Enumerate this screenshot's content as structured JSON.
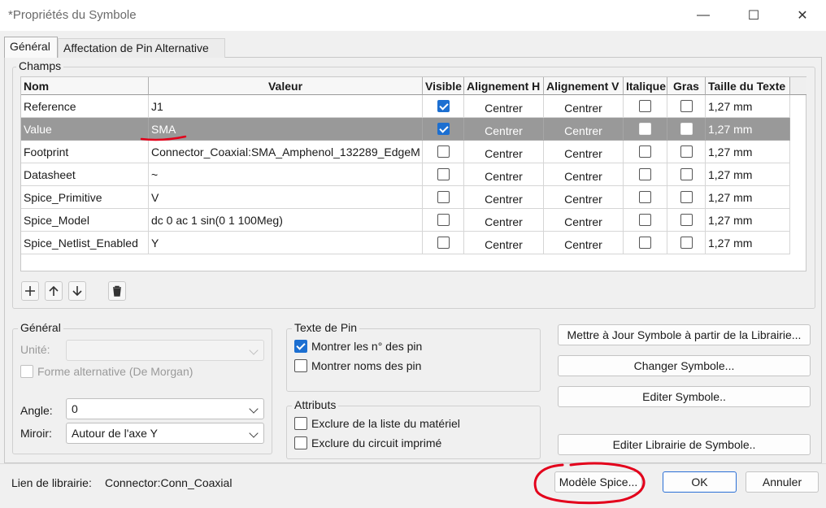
{
  "window": {
    "title": "*Propriétés du Symbole",
    "minimize_glyph": "—",
    "maximize_glyph": "☐",
    "close_glyph": "✕"
  },
  "tabs": [
    {
      "label": "Général"
    },
    {
      "label": "Affectation de Pin Alternative"
    }
  ],
  "fields_group": {
    "label": "Champs",
    "columns": [
      "Nom",
      "Valeur",
      "Visible",
      "Alignement H",
      "Alignement V",
      "Italique",
      "Gras",
      "Taille du Texte"
    ],
    "rows": [
      {
        "name": "Reference",
        "value": "J1",
        "visible": true,
        "align_h": "Centrer",
        "align_v": "Centrer",
        "italic": false,
        "bold": false,
        "size": "1,27 mm"
      },
      {
        "name": "Value",
        "value": "SMA",
        "visible": true,
        "align_h": "Centrer",
        "align_v": "Centrer",
        "italic": false,
        "bold": false,
        "size": "1,27 mm"
      },
      {
        "name": "Footprint",
        "value": "Connector_Coaxial:SMA_Amphenol_132289_EdgeM",
        "visible": false,
        "align_h": "Centrer",
        "align_v": "Centrer",
        "italic": false,
        "bold": false,
        "size": "1,27 mm"
      },
      {
        "name": "Datasheet",
        "value": "~",
        "visible": false,
        "align_h": "Centrer",
        "align_v": "Centrer",
        "italic": false,
        "bold": false,
        "size": "1,27 mm"
      },
      {
        "name": "Spice_Primitive",
        "value": "V",
        "visible": false,
        "align_h": "Centrer",
        "align_v": "Centrer",
        "italic": false,
        "bold": false,
        "size": "1,27 mm"
      },
      {
        "name": "Spice_Model",
        "value": "dc 0 ac 1 sin(0 1 100Meg)",
        "visible": false,
        "align_h": "Centrer",
        "align_v": "Centrer",
        "italic": false,
        "bold": false,
        "size": "1,27 mm"
      },
      {
        "name": "Spice_Netlist_Enabled",
        "value": "Y",
        "visible": false,
        "align_h": "Centrer",
        "align_v": "Centrer",
        "italic": false,
        "bold": false,
        "size": "1,27 mm"
      }
    ],
    "selected_row": 1,
    "toolbar_icons": [
      "add-icon",
      "move-up-icon",
      "move-down-icon",
      "delete-icon"
    ]
  },
  "general_group": {
    "label": "Général",
    "unit_label": "Unité:",
    "unit_value": "",
    "alt_form_label": "Forme alternative (De Morgan)",
    "alt_form_checked": false,
    "angle_label": "Angle:",
    "angle_value": "0",
    "mirror_label": "Miroir:",
    "mirror_value": "Autour de l'axe Y"
  },
  "pin_text_group": {
    "label": "Texte de Pin",
    "show_numbers_label": "Montrer les n° des pin",
    "show_numbers_checked": true,
    "show_names_label": "Montrer noms des pin",
    "show_names_checked": false
  },
  "attributes_group": {
    "label": "Attributs",
    "exclude_bom_label": "Exclure de la liste du matériel",
    "exclude_bom_checked": false,
    "exclude_board_label": "Exclure du circuit imprimé",
    "exclude_board_checked": false
  },
  "side_buttons": {
    "update_from_lib": "Mettre à Jour Symbole à partir de la Librairie...",
    "change_symbol": "Changer Symbole...",
    "edit_symbol": "Editer Symbole..",
    "edit_lib_symbol": "Editer Librairie de Symbole.."
  },
  "footer": {
    "lib_link_label": "Lien de librairie:",
    "lib_link_value": "Connector:Conn_Coaxial",
    "spice_model_button": "Modèle Spice...",
    "ok_button": "OK",
    "cancel_button": "Annuler"
  },
  "colors": {
    "selected_row": "#999999",
    "checkbox_checked": "#1c6fd1",
    "annotation": "#e3001b",
    "primary_border": "#2a6fd6"
  }
}
